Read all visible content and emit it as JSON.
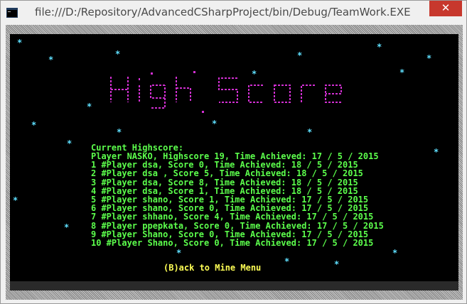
{
  "window": {
    "title": "file:///D:/Repository/AdvancedCSharpProject/bin/Debug/TeamWork.EXE",
    "close_glyph": "✕"
  },
  "console": {
    "banner_text": "High Score",
    "header": "Current Highscore:",
    "entries": [
      "Player NASKO, Highscore 19, Time Achieved: 17 / 5 / 2015",
      "1 #Player dsa, Score 0, Time Achieved: 18 / 5 / 2015",
      "2 #Player dsa , Score 5, Time Achieved: 18 / 5 / 2015",
      "3 #Player dsa, Score 8, Time Achieved: 18 / 5 / 2015",
      "4 #Player dsa, Score 1, Time Achieved: 18 / 5 / 2015",
      "5 #Player shano, Score 1, Time Achieved: 17 / 5 / 2015",
      "6 #Player shano, Score 0, Time Achieved: 17 / 5 / 2015",
      "7 #Player shhano, Score 4, Time Achieved: 17 / 5 / 2015",
      "8 #Player ppepkata, Score 0, Time Achieved: 17 / 5 / 2015",
      "9 #Player Shano, Score 0, Time Achieved: 17 / 5 / 2015",
      "10 #Player Shano, Score 0, Time Achieved: 17 / 5 / 2015"
    ],
    "back_label": "(B)ack to Mine Menu",
    "star_glyph": "*",
    "colors": {
      "background": "#000000",
      "list_text": "#5cff4c",
      "back_text": "#ffff55",
      "stars": "#5fe0ff",
      "banner": "#d12fd1"
    }
  }
}
